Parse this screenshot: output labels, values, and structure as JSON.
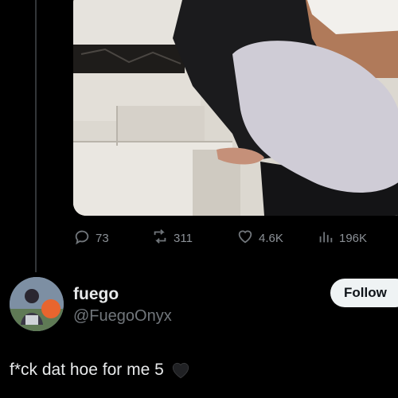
{
  "actions": {
    "replies": "73",
    "reposts": "311",
    "likes": "4.6K",
    "views": "196K"
  },
  "author": {
    "name": "fuego",
    "handle": "@FuegoOnyx",
    "follow_label": "Follow"
  },
  "tweet": {
    "text": "f*ck dat hoe for me 5",
    "emoji": "black-heart"
  },
  "colors": {
    "background": "#000000",
    "text_primary": "#e7e9ea",
    "text_secondary": "#71767b",
    "follow_button_bg": "#eff3f4"
  }
}
